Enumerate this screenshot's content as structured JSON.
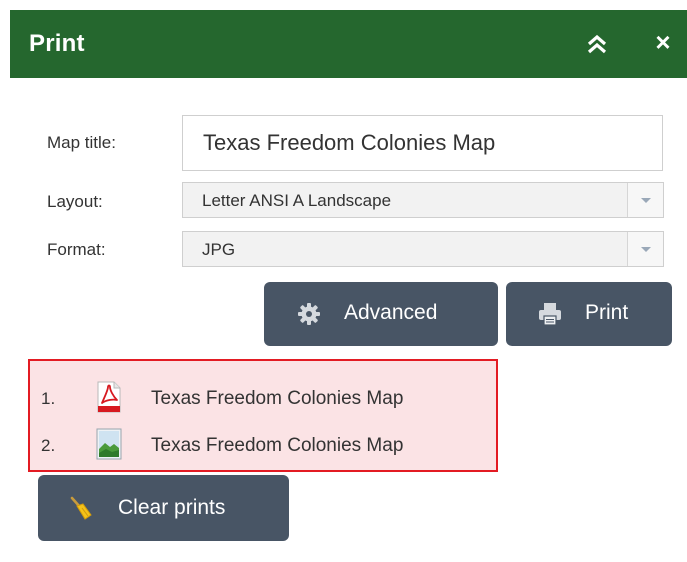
{
  "header": {
    "title": "Print",
    "collapse_icon": "double-chevron-up-icon",
    "close_glyph": "×",
    "background": "#25672e"
  },
  "form": {
    "map_title_label": "Map title:",
    "map_title_value": "Texas Freedom Colonies Map",
    "layout_label": "Layout:",
    "layout_value": "Letter ANSI A Landscape",
    "format_label": "Format:",
    "format_value": "JPG"
  },
  "buttons": {
    "advanced_label": "Advanced",
    "advanced_icon": "gear-icon",
    "print_label": "Print",
    "print_icon": "printer-icon",
    "clear_label": "Clear prints",
    "clear_icon": "broom-icon",
    "color": "#485565"
  },
  "results": {
    "highlight_border": "#e31b23",
    "highlight_fill": "#fbe3e5",
    "items": [
      {
        "number": "1.",
        "name": "Texas Freedom Colonies Map",
        "icon": "pdf-file-icon"
      },
      {
        "number": "2.",
        "name": "Texas Freedom Colonies Map",
        "icon": "image-file-icon"
      }
    ]
  }
}
